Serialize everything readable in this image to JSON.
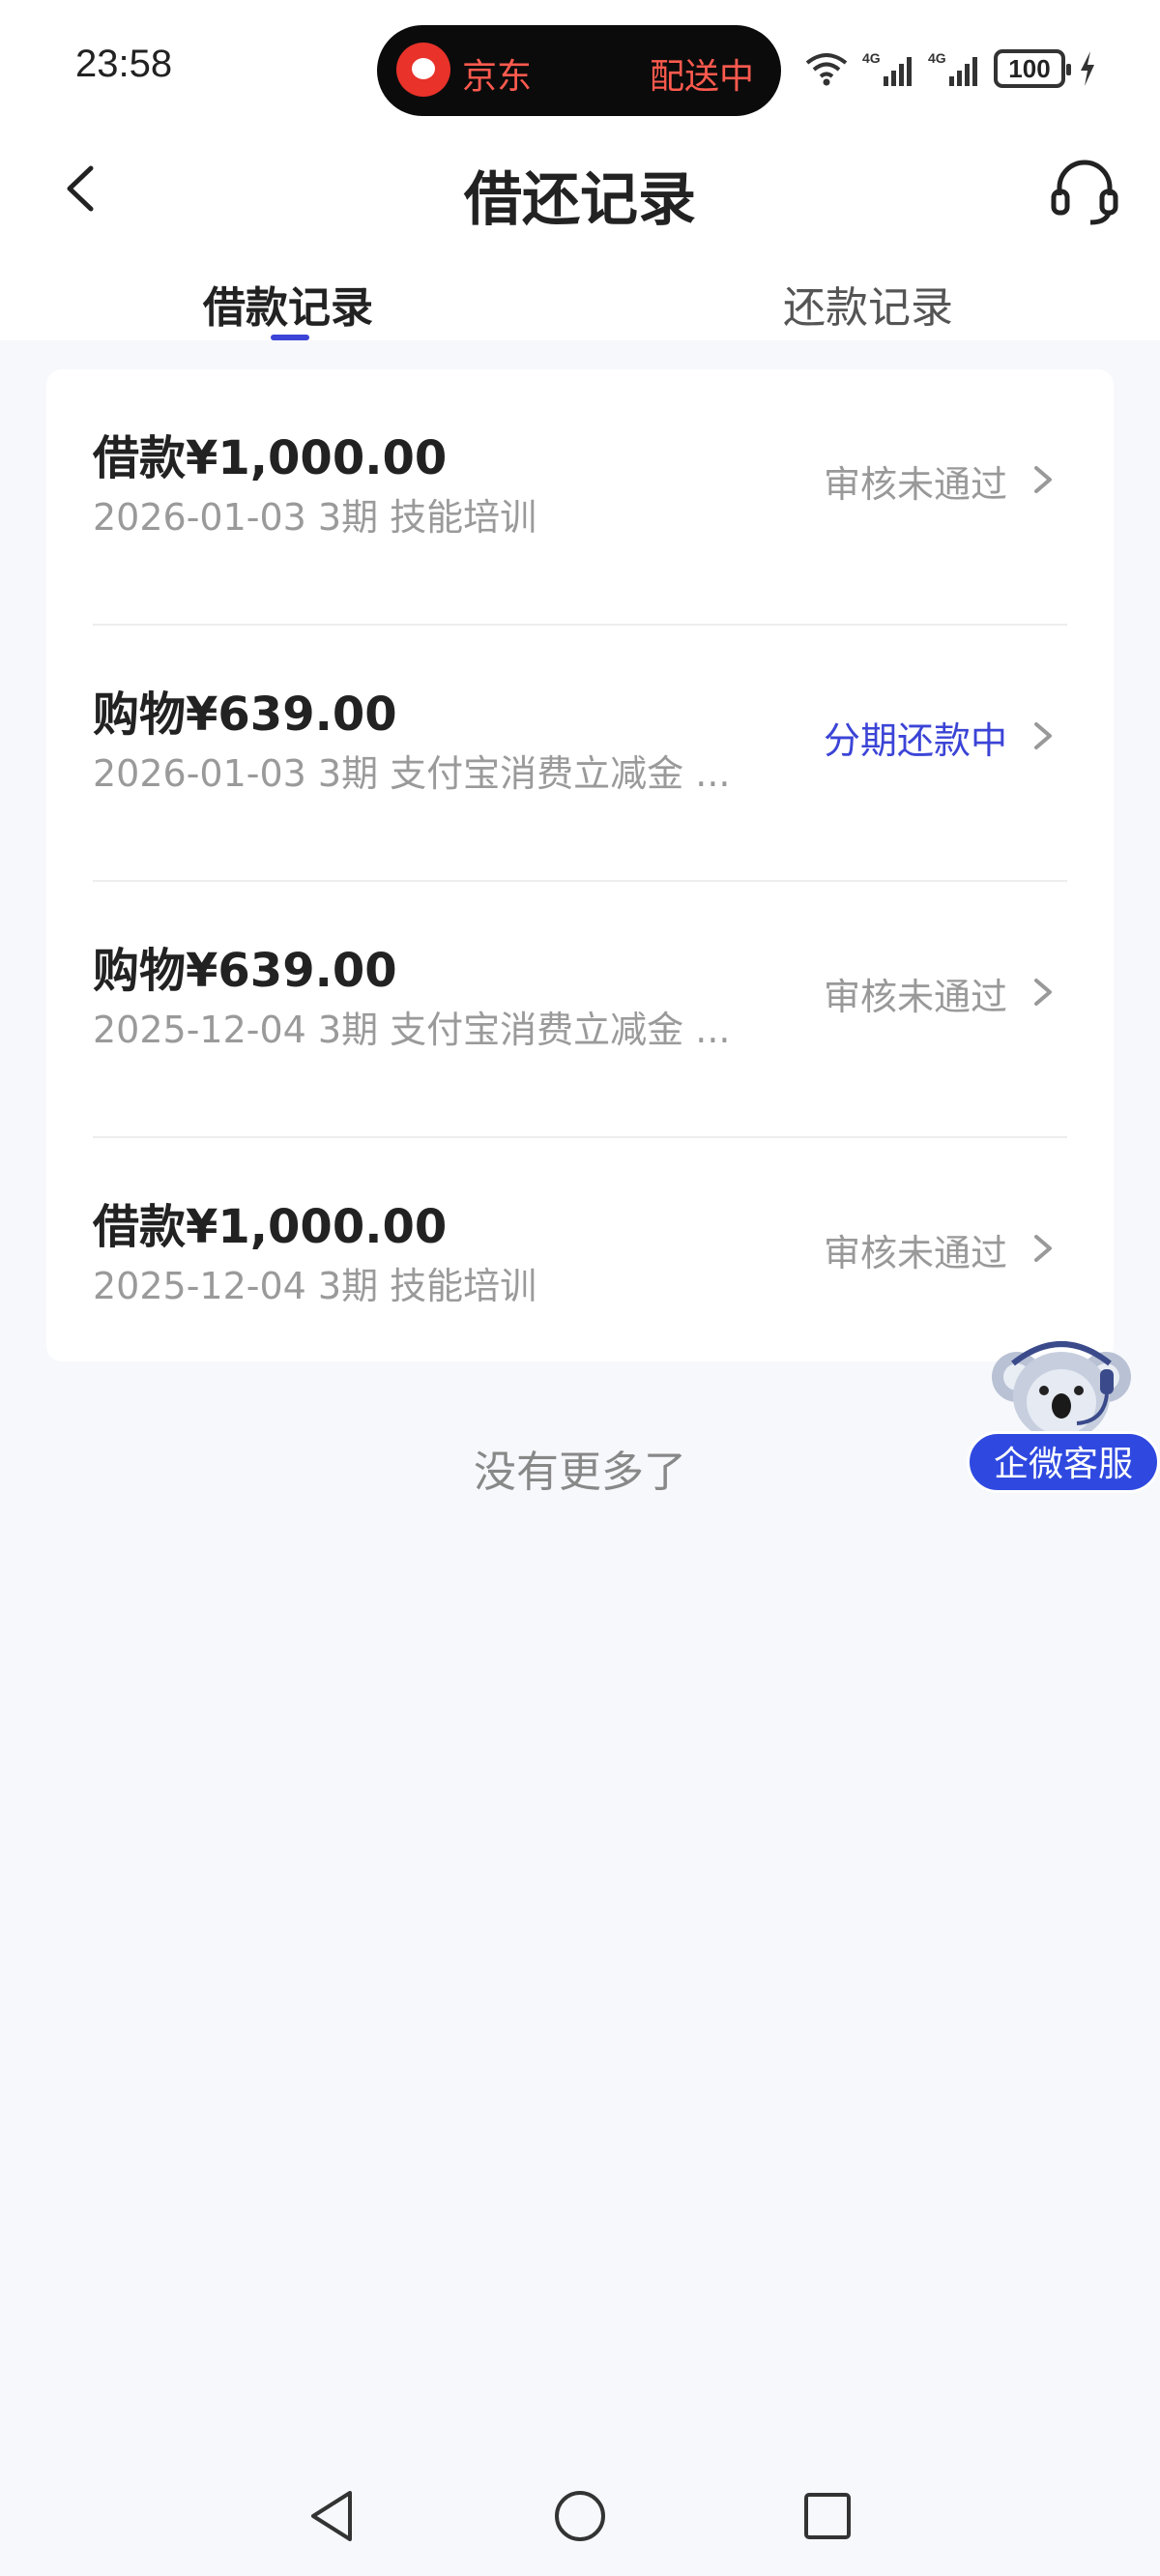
{
  "status_bar": {
    "time": "23:58",
    "pill_app": "京东",
    "pill_status": "配送中",
    "battery": "100"
  },
  "nav": {
    "title": "借还记录"
  },
  "tabs": [
    {
      "label": "借款记录",
      "active": true
    },
    {
      "label": "还款记录",
      "active": false
    }
  ],
  "records": [
    {
      "title": "借款¥1,000.00",
      "subtitle": "2026-01-03 3期  技能培训",
      "status": "审核未通过",
      "status_color": "#999999"
    },
    {
      "title": "购物¥639.00",
      "subtitle": "2026-01-03 3期  支付宝消费立减金 ...",
      "status": "分期还款中",
      "status_color": "#3b44d6"
    },
    {
      "title": "购物¥639.00",
      "subtitle": "2025-12-04 3期  支付宝消费立减金 ...",
      "status": "审核未通过",
      "status_color": "#999999"
    },
    {
      "title": "借款¥1,000.00",
      "subtitle": "2025-12-04 3期  技能培训",
      "status": "审核未通过",
      "status_color": "#999999"
    }
  ],
  "footer_text": "没有更多了",
  "floater": {
    "label": "企微客服"
  },
  "colors": {
    "accent": "#3b44d6",
    "floater_blue": "#2f49e0",
    "background": "#f7f8fc"
  }
}
